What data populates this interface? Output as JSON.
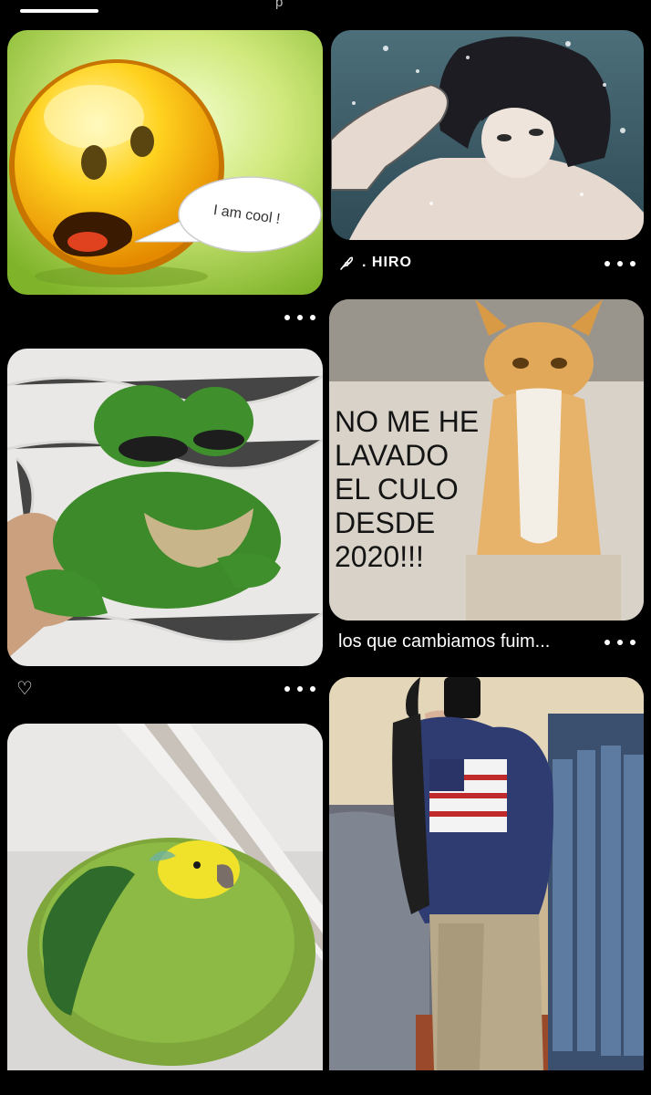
{
  "top_tab": {
    "partial_label": "p"
  },
  "pins": [
    {
      "id": "emoji",
      "bubble_text": "I am cool !"
    },
    {
      "id": "anime",
      "author_name": ". HIRO",
      "author_icon": "feather-icon"
    },
    {
      "id": "cat-meme",
      "meme_lines": [
        "NO ME HE",
        "LAVADO",
        "EL CULO",
        "DESDE",
        "2020!!!"
      ],
      "title": "los que cambiamos fuim..."
    },
    {
      "id": "frog",
      "reaction_glyph": "♡"
    },
    {
      "id": "parrot"
    },
    {
      "id": "mirror-selfie"
    }
  ],
  "icons": {
    "more": "more-dots-icon",
    "heart": "heart-icon",
    "feather": "feather-icon"
  }
}
